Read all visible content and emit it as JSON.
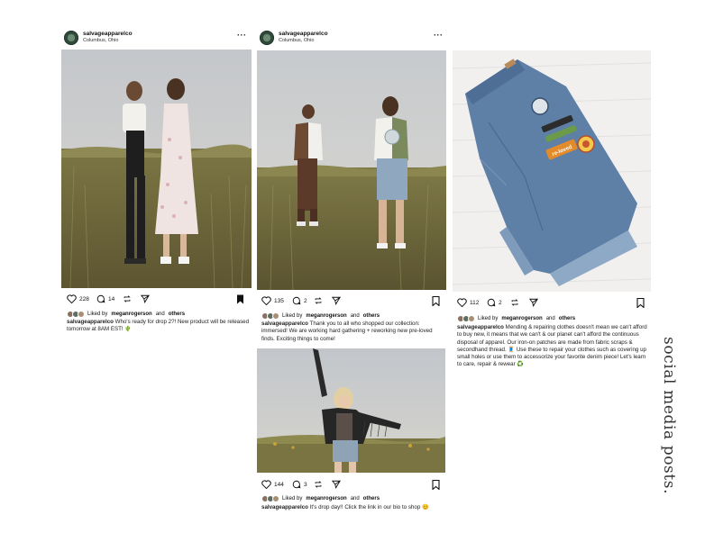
{
  "account": {
    "username": "salvageapparelco",
    "location": "Columbus, Ohio"
  },
  "side_title": "social media posts.",
  "posts": [
    {
      "likes_count": "228",
      "comments_count": "14",
      "liked_by": "meganrogerson",
      "liked_prefix": "Liked by",
      "and_text": "and",
      "others_text": "others",
      "caption": "Who's ready for drop 2?! New product will be released tomorrow at 8AM EST! 🌵",
      "bookmark": "filled"
    },
    {
      "likes_count": "135",
      "comments_count": "2",
      "liked_by": "meganrogerson",
      "liked_prefix": "Liked by",
      "and_text": "and",
      "others_text": "others",
      "caption": "Thank you to all who shopped our collection: immersed! We are working hard gathering + reworking new pre-loved finds. Exciting things to come!"
    },
    {
      "likes_count": "144",
      "comments_count": "3",
      "liked_by": "meganrogerson",
      "liked_prefix": "Liked by",
      "and_text": "and",
      "others_text": "others",
      "caption": "It's drop day!! Click the link in our bio to shop 😊"
    },
    {
      "likes_count": "112",
      "comments_count": "2",
      "liked_by": "meganrogerson",
      "liked_prefix": "Liked by",
      "and_text": "and",
      "others_text": "others",
      "caption": "Mending & repairing clothes doesn't mean we can't afford to buy new, it means that we can't & our planet can't afford the continuous disposal of apparel. Our iron-on patches are made from fabric scraps & secondhand thread. 🧵 Use these to repair your clothes such as covering up small holes or use them to accessorize your favorite denim piece! Let's learn to care, repair & rewear ♻️"
    }
  ],
  "patch_text": {
    "orange": "re-loved"
  },
  "colors": {
    "brand_green": "#2f4a3a",
    "sky": "#c9ccd0",
    "grass": "#6f6a3e"
  }
}
